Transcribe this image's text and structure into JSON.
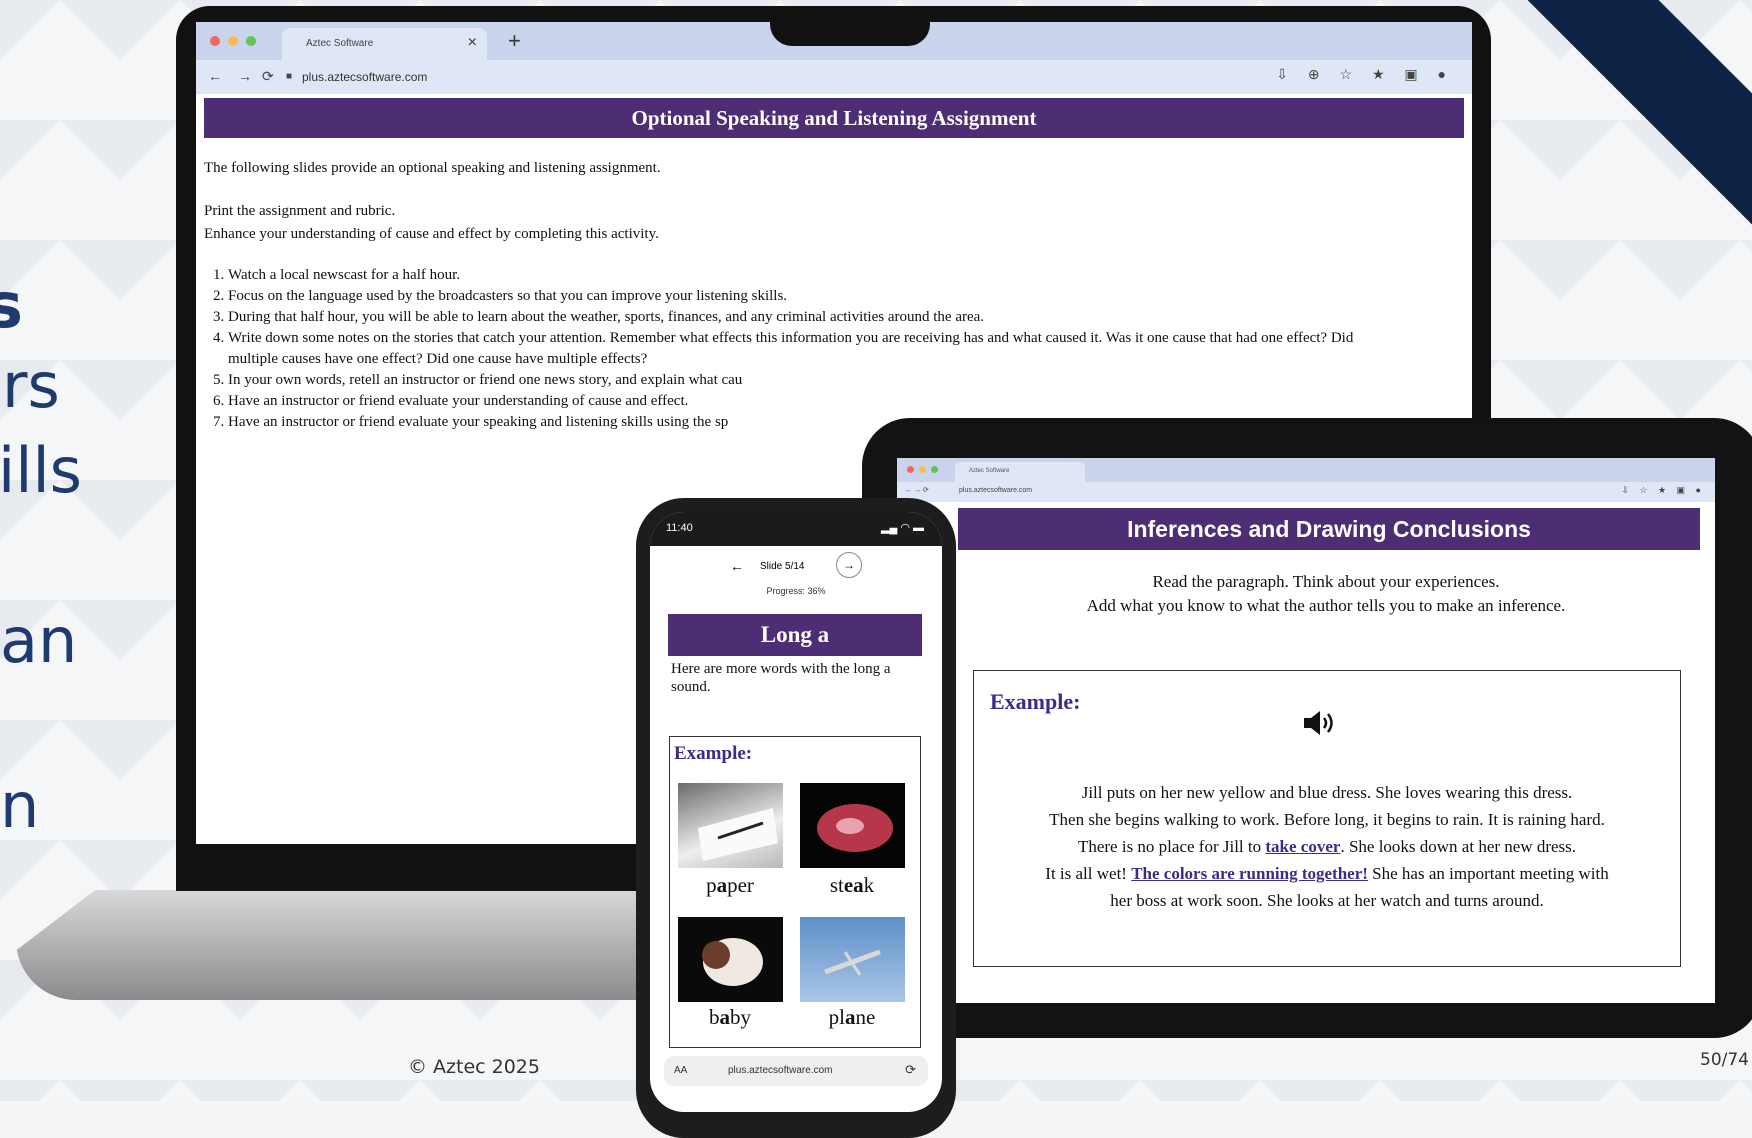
{
  "side_text": [
    "s",
    "rs",
    "ills",
    "an",
    "n"
  ],
  "footer": {
    "copyright": "© Aztec 2025",
    "page": "50/74"
  },
  "colors": {
    "banner": "#4d2d73",
    "navy": "#0f2347",
    "orange": "#f08a1c"
  },
  "laptop": {
    "tab_title": "Aztec Software",
    "url": "plus.aztecsoftware.com",
    "banner": "Optional Speaking and Listening Assignment",
    "intro": "The following slides provide an optional speaking and listening assignment.",
    "print": "Print the assignment and rubric.",
    "enhance": "Enhance your understanding of cause and effect by completing this activity.",
    "steps": [
      "Watch a local newscast for a half hour.",
      "Focus on the language used by the broadcasters so that you can improve your listening skills.",
      "During that half hour, you will be able to learn about the weather, sports, finances, and any criminal activities around the area.",
      "Write down some notes on the stories that catch your attention. Remember what effects this information you are receiving has and what caused it. Was it one cause that had one effect? Did multiple causes have one effect? Did one cause have multiple effects?",
      "In your own words, retell an instructor or friend one news story, and explain what cau",
      "Have an instructor or friend evaluate your understanding of cause and effect.",
      "Have an instructor or friend evaluate your speaking and listening skills using the sp"
    ]
  },
  "tablet": {
    "banner": "Inferences and Drawing Conclusions",
    "instr1": "Read the paragraph. Think about your experiences.",
    "instr2": "Add what you know to what the author tells you to make an inference.",
    "example_label": "Example:",
    "audio_icon": "speaker-icon",
    "p1": "Jill puts on her new yellow and blue dress. She loves wearing this dress.",
    "p2": "Then she begins walking to work. Before long, it begins to rain. It is raining hard.",
    "p3a": "There is no place for Jill to ",
    "link1": "take cover",
    "p3b": ". She looks down at her new dress.",
    "p4a": "It is all wet! ",
    "link2": "The colors are running together!",
    "p4b": " She has an important meeting with",
    "p5": "her boss at work soon. She looks at her watch and turns around."
  },
  "phone": {
    "time": "11:40",
    "slide": "Slide 5/14",
    "progress": "Progress: 36%",
    "banner": "Long a",
    "desc": "Here are more words with the long a sound.",
    "example_label": "Example:",
    "url": "plus.aztecsoftware.com",
    "aa": "AA",
    "words": [
      {
        "pre": "p",
        "mid": "a",
        "post": "per"
      },
      {
        "pre": "st",
        "mid": "ea",
        "post": "k"
      },
      {
        "pre": "b",
        "mid": "a",
        "post": "by"
      },
      {
        "pre": "pl",
        "mid": "a",
        "post": "ne"
      }
    ]
  }
}
